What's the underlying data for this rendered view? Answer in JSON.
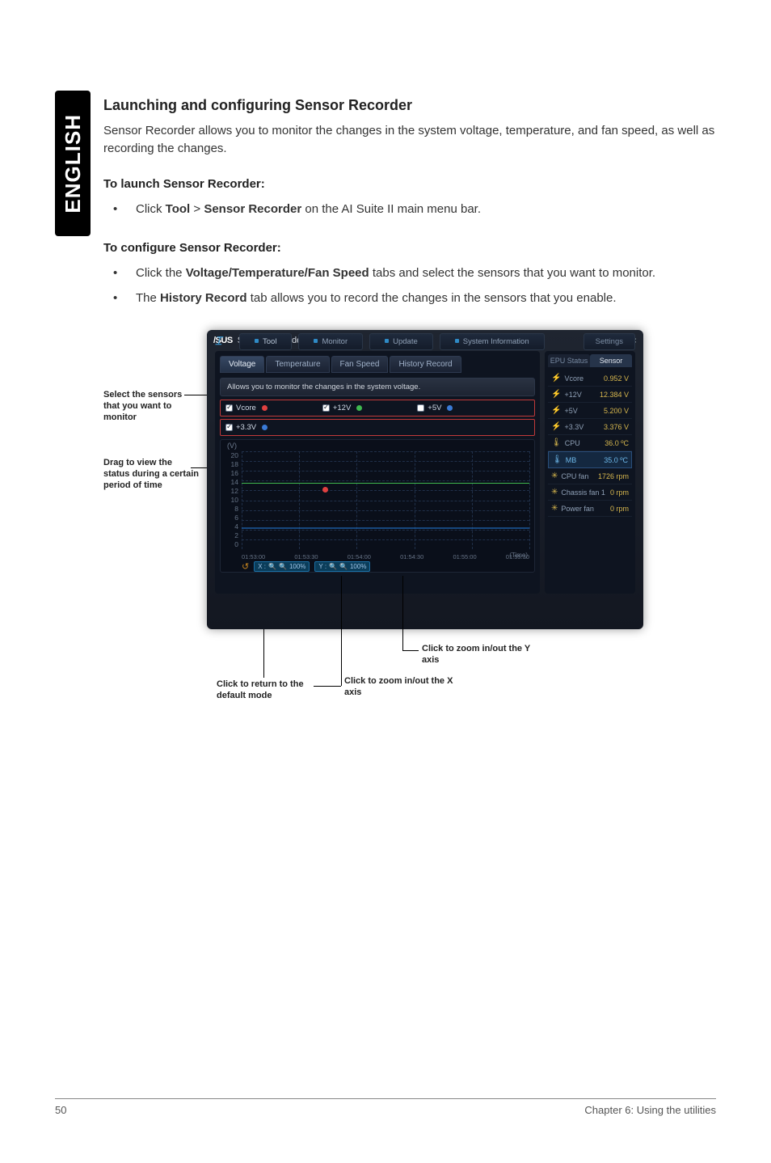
{
  "sidebar": {
    "language": "ENGLISH"
  },
  "section": {
    "heading": "Launching and configuring Sensor Recorder",
    "intro": "Sensor Recorder allows you to monitor the changes in the system voltage, temperature, and fan speed, as well as recording the changes.",
    "launch_h": "To launch Sensor Recorder:",
    "launch_items": [
      {
        "pre": "Click ",
        "b1": "Tool",
        "mid": " > ",
        "b2": "Sensor Recorder",
        "post": " on the AI Suite II main menu bar."
      }
    ],
    "config_h": "To configure Sensor Recorder:",
    "config_items": [
      {
        "pre": "Click the ",
        "b1": "Voltage/Temperature/Fan Speed",
        "post": " tabs and select the sensors that you want to monitor."
      },
      {
        "pre": "The ",
        "b1": "History Record",
        "post": " tab allows you to record the changes in the sensors that you enable."
      }
    ]
  },
  "ann": {
    "select": "Select the sensors that you want to monitor",
    "drag": "Drag to view the status during a certain period of time",
    "return": "Click to return to the default mode",
    "zoomx": "Click to zoom in/out the X axis",
    "zoomy": "Click to zoom in/out the Y axis"
  },
  "app": {
    "logo": "/SUS",
    "title": "Sensor Recorder",
    "tabs": {
      "voltage": "Voltage",
      "temperature": "Temperature",
      "fanspeed": "Fan Speed",
      "history": "History Record"
    },
    "msg": "Allows you to monitor the changes in the system voltage.",
    "checks": {
      "vcore": "Vcore",
      "p12v": "+12V",
      "p5v": "+5V",
      "p33v": "+3.3V"
    },
    "chart": {
      "y_unit": "(V)",
      "y": [
        "20",
        "18",
        "16",
        "14",
        "12",
        "10",
        "8",
        "6",
        "4",
        "2",
        "0"
      ],
      "x": [
        "01:53:00",
        "01:53:30",
        "01:54:00",
        "01:54:30",
        "01:55:00",
        "01:55:30"
      ],
      "zoom_reset": "↺",
      "zoom_x_label": "X :",
      "zoom_y_label": "Y :",
      "zoom_100": "100%",
      "time": "(Time)"
    },
    "rp": {
      "tab_epu": "EPU Status",
      "tab_sensor": "Sensor",
      "rows": [
        {
          "icon": "⚡",
          "label": "Vcore",
          "value": "0.952 V"
        },
        {
          "icon": "⚡",
          "label": "+12V",
          "value": "12.384 V"
        },
        {
          "icon": "⚡",
          "label": "+5V",
          "value": "5.200 V"
        },
        {
          "icon": "⚡",
          "label": "+3.3V",
          "value": "3.376 V"
        },
        {
          "icon": "🌡",
          "label": "CPU",
          "value": "36.0 ºC"
        },
        {
          "icon": "🌡",
          "label": "MB",
          "value": "35.0 ºC",
          "sel": true
        },
        {
          "icon": "✳",
          "label": "CPU fan",
          "value": "1726 rpm"
        },
        {
          "icon": "✳",
          "label": "Chassis fan 1",
          "value": "0 rpm"
        },
        {
          "icon": "✳",
          "label": "Power fan",
          "value": "0 rpm"
        }
      ]
    },
    "bottom": {
      "logo": "⌶",
      "tool": "Tool",
      "monitor": "Monitor",
      "update": "Update",
      "sysinfo": "System Information",
      "settings": "Settings"
    }
  },
  "chart_data": {
    "type": "line",
    "title": "Allows you to monitor the changes in the system voltage.",
    "xlabel": "(Time)",
    "ylabel": "(V)",
    "ylim": [
      0,
      20
    ],
    "x": [
      "01:53:00",
      "01:53:30",
      "01:54:00",
      "01:54:30",
      "01:55:00",
      "01:55:30"
    ],
    "series": [
      {
        "name": "Vcore",
        "color": "#e04040",
        "values": [
          null,
          12.4,
          null,
          null,
          null,
          null
        ]
      },
      {
        "name": "+12V",
        "color": "#3fb84f",
        "values": [
          12.4,
          12.4,
          12.4,
          12.4,
          12.4,
          12.4
        ]
      },
      {
        "name": "+5V",
        "color": "#3a7ad6",
        "values": [
          5.2,
          5.2,
          5.2,
          5.2,
          5.2,
          5.2
        ]
      },
      {
        "name": "+3.3V",
        "color": "#3a7ad6",
        "values": [
          3.4,
          3.4,
          3.4,
          3.4,
          3.4,
          3.4
        ]
      }
    ]
  },
  "footer": {
    "page": "50",
    "chapter": "Chapter 6: Using the utilities"
  }
}
